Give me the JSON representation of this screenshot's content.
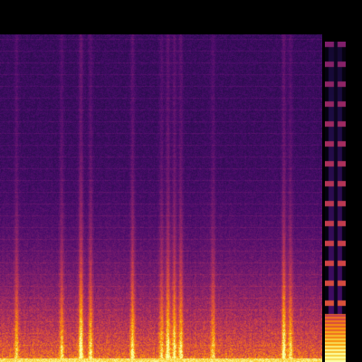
{
  "chart_data": {
    "type": "heatmap",
    "title": "",
    "xlabel": "",
    "ylabel": "",
    "colormap": [
      "#000004",
      "#1b0c41",
      "#4a0c6b",
      "#781c6d",
      "#a52c60",
      "#cf4446",
      "#ed6925",
      "#fb9b06",
      "#f7d13d",
      "#fcffa4"
    ],
    "background_level": 0.14,
    "low_frequency_emphasis": 0.55,
    "vertical_streaks": [
      {
        "x_fraction": 0.05,
        "strength": 0.45
      },
      {
        "x_fraction": 0.19,
        "strength": 0.5
      },
      {
        "x_fraction": 0.25,
        "strength": 0.8
      },
      {
        "x_fraction": 0.28,
        "strength": 0.55
      },
      {
        "x_fraction": 0.41,
        "strength": 0.6
      },
      {
        "x_fraction": 0.5,
        "strength": 0.5
      },
      {
        "x_fraction": 0.52,
        "strength": 0.7
      },
      {
        "x_fraction": 0.54,
        "strength": 0.65
      },
      {
        "x_fraction": 0.56,
        "strength": 0.6
      },
      {
        "x_fraction": 0.66,
        "strength": 0.45
      },
      {
        "x_fraction": 0.88,
        "strength": 0.75
      },
      {
        "x_fraction": 0.9,
        "strength": 0.5
      }
    ],
    "bottom_band_level": 1.0,
    "colorbar_visible": true
  }
}
